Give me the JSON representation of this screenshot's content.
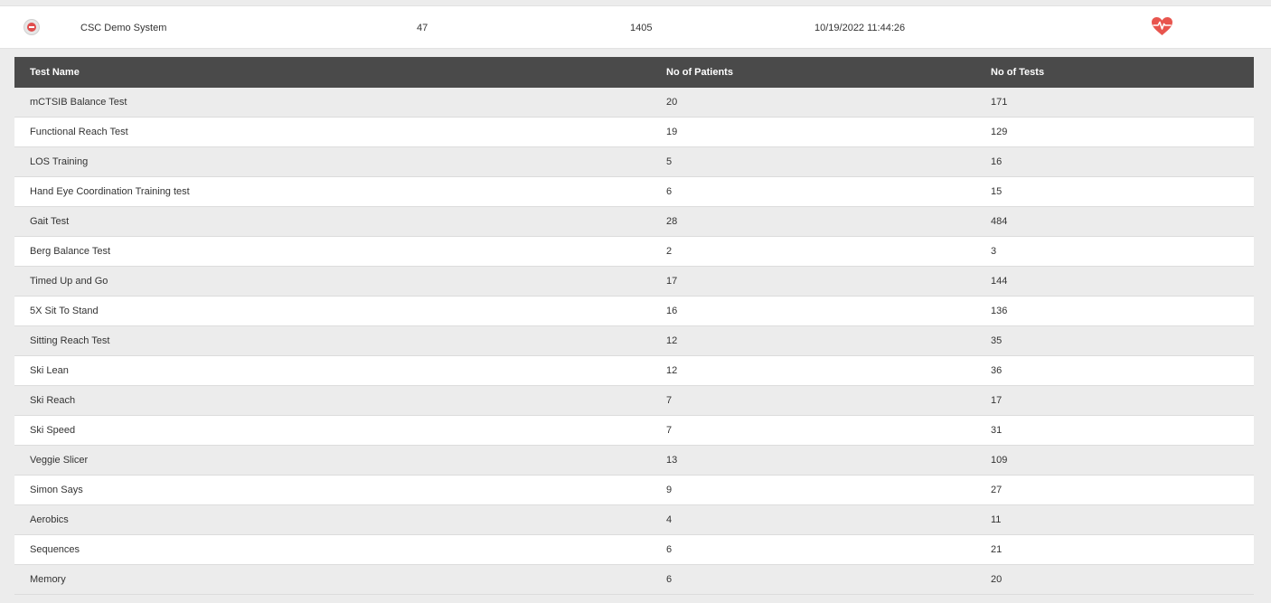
{
  "system": {
    "name": "CSC Demo System",
    "patients": "47",
    "tests": "1405",
    "last_updated": "10/19/2022 11:44:26",
    "heart_color": "#e8554e"
  },
  "table": {
    "columns": [
      "Test Name",
      "No of Patients",
      "No of Tests"
    ],
    "rows": [
      {
        "name": "mCTSIB Balance Test",
        "patients": "20",
        "tests": "171"
      },
      {
        "name": "Functional Reach Test",
        "patients": "19",
        "tests": "129"
      },
      {
        "name": "LOS Training",
        "patients": "5",
        "tests": "16"
      },
      {
        "name": "Hand Eye Coordination Training test",
        "patients": "6",
        "tests": "15"
      },
      {
        "name": "Gait Test",
        "patients": "28",
        "tests": "484"
      },
      {
        "name": "Berg Balance Test",
        "patients": "2",
        "tests": "3"
      },
      {
        "name": "Timed Up and Go",
        "patients": "17",
        "tests": "144"
      },
      {
        "name": "5X Sit To Stand",
        "patients": "16",
        "tests": "136"
      },
      {
        "name": "Sitting Reach Test",
        "patients": "12",
        "tests": "35"
      },
      {
        "name": "Ski Lean",
        "patients": "12",
        "tests": "36"
      },
      {
        "name": "Ski Reach",
        "patients": "7",
        "tests": "17"
      },
      {
        "name": "Ski Speed",
        "patients": "7",
        "tests": "31"
      },
      {
        "name": "Veggie Slicer",
        "patients": "13",
        "tests": "109"
      },
      {
        "name": "Simon Says",
        "patients": "9",
        "tests": "27"
      },
      {
        "name": "Aerobics",
        "patients": "4",
        "tests": "11"
      },
      {
        "name": "Sequences",
        "patients": "6",
        "tests": "21"
      },
      {
        "name": "Memory",
        "patients": "6",
        "tests": "20"
      }
    ]
  }
}
